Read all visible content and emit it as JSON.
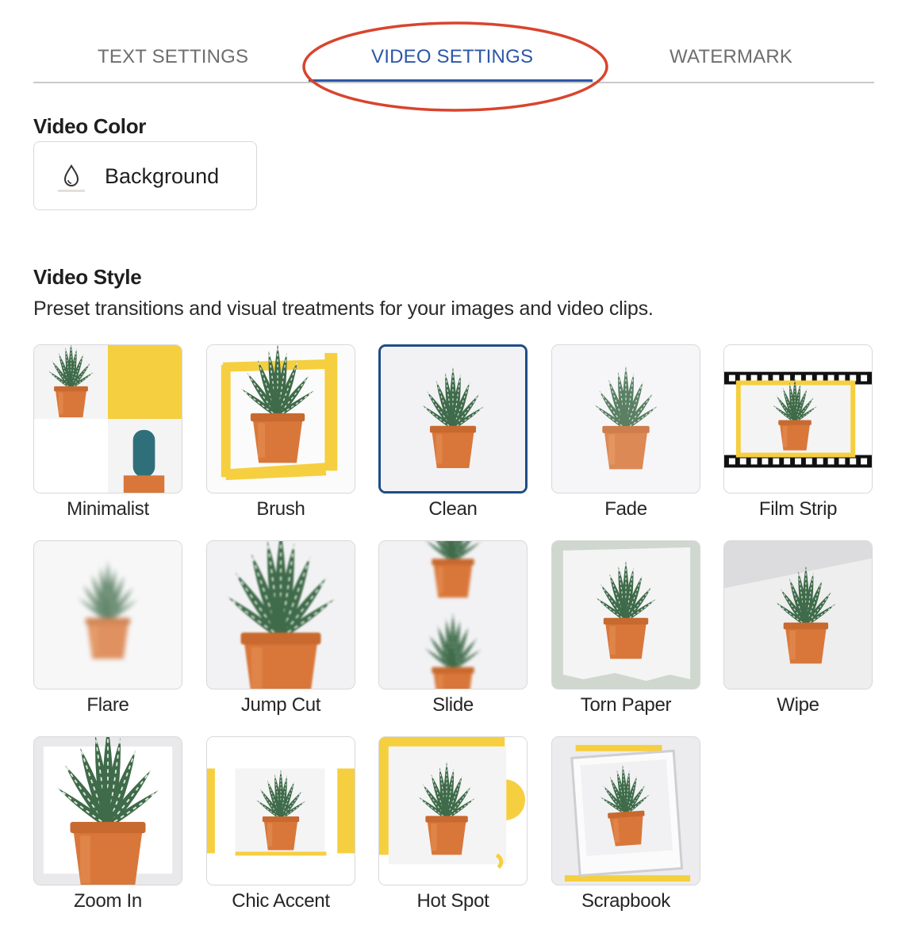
{
  "tabs": [
    {
      "label": "TEXT SETTINGS",
      "active": false
    },
    {
      "label": "VIDEO SETTINGS",
      "active": true
    },
    {
      "label": "WATERMARK",
      "active": false
    }
  ],
  "annotation_color": "#d9442e",
  "accent_color": "#2b57a8",
  "video_color": {
    "title": "Video Color",
    "button_label": "Background",
    "button_icon": "droplet-icon"
  },
  "video_style": {
    "title": "Video Style",
    "description": "Preset transitions and visual treatments for your images and video clips.",
    "selected": "Clean",
    "styles": [
      {
        "label": "Minimalist"
      },
      {
        "label": "Brush"
      },
      {
        "label": "Clean"
      },
      {
        "label": "Fade"
      },
      {
        "label": "Film Strip"
      },
      {
        "label": "Flare"
      },
      {
        "label": "Jump Cut"
      },
      {
        "label": "Slide"
      },
      {
        "label": "Torn Paper"
      },
      {
        "label": "Wipe"
      },
      {
        "label": "Zoom In"
      },
      {
        "label": "Chic Accent"
      },
      {
        "label": "Hot Spot"
      },
      {
        "label": "Scrapbook"
      }
    ]
  },
  "colors": {
    "accent_yellow": "#f5cf3f",
    "pot_orange": "#d9773a",
    "plant_green": "#3f6b4a",
    "selected_border": "#1f4d86"
  }
}
